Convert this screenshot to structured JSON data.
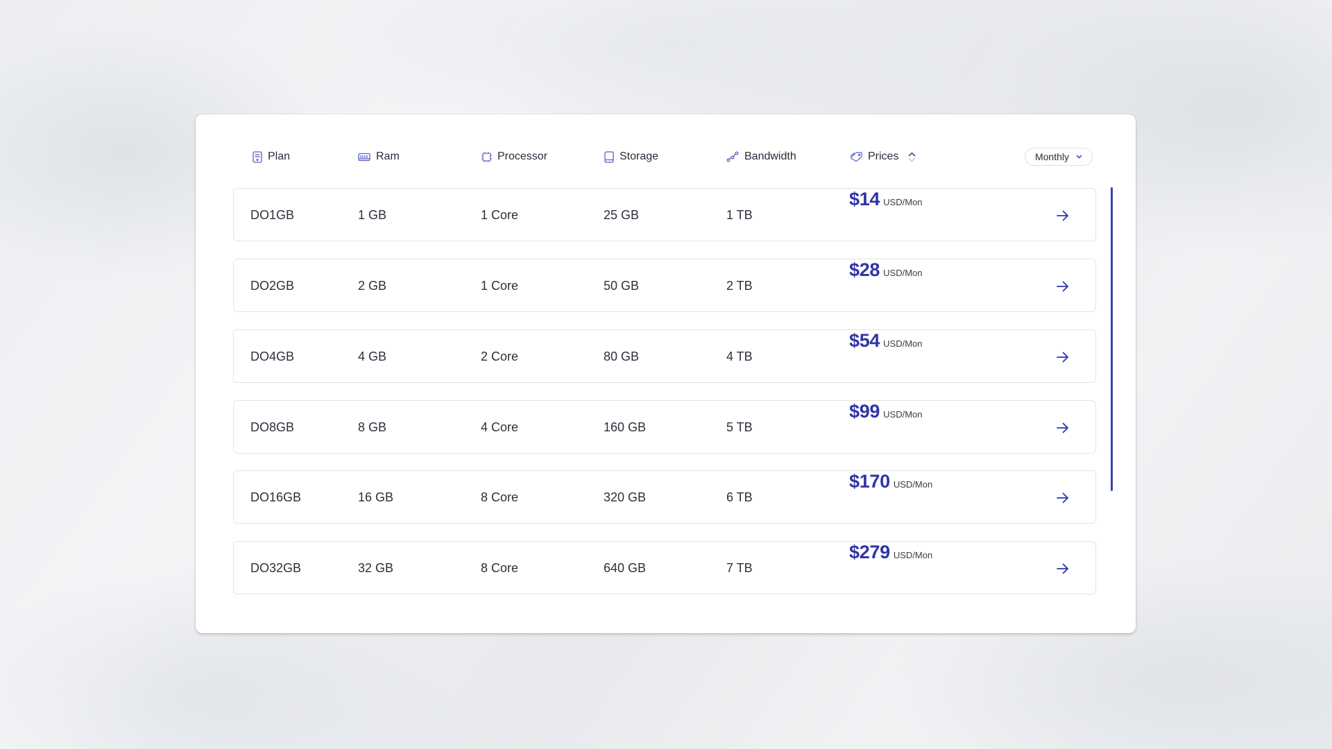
{
  "header": {
    "columns": [
      {
        "key": "plan",
        "label": "Plan",
        "icon": "server-icon"
      },
      {
        "key": "ram",
        "label": "Ram",
        "icon": "memory-icon"
      },
      {
        "key": "processor",
        "label": "Processor",
        "icon": "cpu-icon"
      },
      {
        "key": "storage",
        "label": "Storage",
        "icon": "storage-icon"
      },
      {
        "key": "bandwidth",
        "label": "Bandwidth",
        "icon": "bandwidth-icon"
      },
      {
        "key": "prices",
        "label": "Prices",
        "icon": "price-tag-icon",
        "sortable": true,
        "sort": "ascending"
      }
    ],
    "billing_period": {
      "selected": "Monthly"
    }
  },
  "rows": [
    {
      "plan": "DO1GB",
      "ram": "1 GB",
      "processor": "1 Core",
      "storage": "25 GB",
      "bandwidth": "1 TB",
      "price": "$14",
      "unit": "USD/Mon"
    },
    {
      "plan": "DO2GB",
      "ram": "2 GB",
      "processor": "1 Core",
      "storage": "50 GB",
      "bandwidth": "2 TB",
      "price": "$28",
      "unit": "USD/Mon"
    },
    {
      "plan": "DO4GB",
      "ram": "4 GB",
      "processor": "2 Core",
      "storage": "80 GB",
      "bandwidth": "4 TB",
      "price": "$54",
      "unit": "USD/Mon"
    },
    {
      "plan": "DO8GB",
      "ram": "8 GB",
      "processor": "4 Core",
      "storage": "160 GB",
      "bandwidth": "5 TB",
      "price": "$99",
      "unit": "USD/Mon"
    },
    {
      "plan": "DO16GB",
      "ram": "16 GB",
      "processor": "8 Core",
      "storage": "320 GB",
      "bandwidth": "6 TB",
      "price": "$170",
      "unit": "USD/Mon"
    },
    {
      "plan": "DO32GB",
      "ram": "32 GB",
      "processor": "8 Core",
      "storage": "640 GB",
      "bandwidth": "7 TB",
      "price": "$279",
      "unit": "USD/Mon"
    }
  ],
  "colors": {
    "accent": "#2f35a8",
    "icon": "#5b5fc7",
    "text": "#2f2f3c",
    "row_border": "#e3e4e8"
  }
}
